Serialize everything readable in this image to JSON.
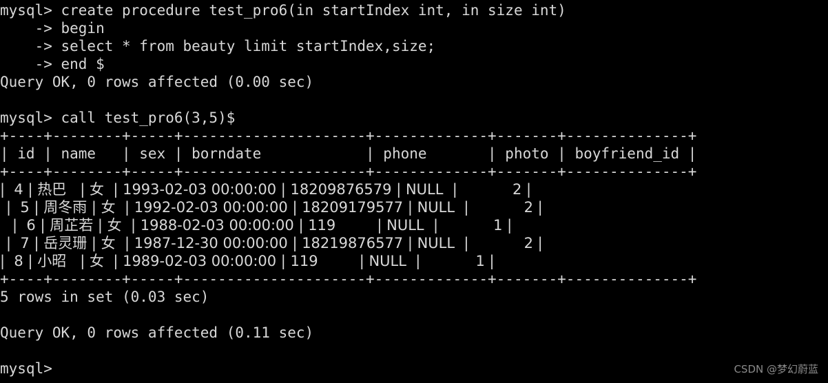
{
  "terminal": {
    "prompt": "mysql>",
    "continuation_prompt": "    ->",
    "background_color": "#000000",
    "foreground_color": "#d8d8d8",
    "cols": 92,
    "rows": 21
  },
  "session": {
    "lines": [
      {
        "id": "l01",
        "kind": "command",
        "text": "mysql> create procedure test_pro6(in startIndex int, in size int)"
      },
      {
        "id": "l02",
        "kind": "continuation",
        "text": "    -> begin"
      },
      {
        "id": "l03",
        "kind": "continuation",
        "text": "    -> select * from beauty limit startIndex,size;"
      },
      {
        "id": "l04",
        "kind": "continuation",
        "text": "    -> end $"
      },
      {
        "id": "l05",
        "kind": "status",
        "text": "Query OK, 0 rows affected (0.00 sec)"
      },
      {
        "id": "l06",
        "kind": "blank",
        "text": " "
      },
      {
        "id": "l07",
        "kind": "command",
        "text": "mysql> call test_pro6(3,5)$"
      }
    ],
    "result_footer": [
      {
        "id": "f01",
        "kind": "status",
        "text": "5 rows in set (0.03 sec)"
      },
      {
        "id": "f02",
        "kind": "blank",
        "text": " "
      },
      {
        "id": "f03",
        "kind": "status",
        "text": "Query OK, 0 rows affected (0.11 sec)"
      },
      {
        "id": "f04",
        "kind": "blank",
        "text": " "
      },
      {
        "id": "f05",
        "kind": "command",
        "text": "mysql>"
      }
    ]
  },
  "result_table": {
    "border_top": "+----+--------+-----+---------------------+-------------+-------+--------------+",
    "border_header": "+----+--------+-----+---------------------+-------------+-------+--------------+",
    "border_bottom": "+----+--------+-----+---------------------+-------------+-------+--------------+",
    "header_line": "| id | name   | sex | borndate            | phone       | photo | boyfriend_id |",
    "columns": [
      "id",
      "name",
      "sex",
      "borndate",
      "phone",
      "photo",
      "boyfriend_id"
    ],
    "rows": [
      {
        "line": "|  4 | 热巴   | 女  | 1993-02-03 00:00:00 | 18209876579 | NULL  |            2 |",
        "id": "4",
        "name": "热巴",
        "sex": "女",
        "borndate": "1993-02-03 00:00:00",
        "phone": "18209876579",
        "photo": "NULL",
        "boyfriend_id": "2"
      },
      {
        "line": "|  5 | 周冬雨 | 女  | 1992-02-03 00:00:00 | 18209179577 | NULL  |            2 |",
        "id": "5",
        "name": "周冬雨",
        "sex": "女",
        "borndate": "1992-02-03 00:00:00",
        "phone": "18209179577",
        "photo": "NULL",
        "boyfriend_id": "2"
      },
      {
        "line": "|  6 | 周芷若 | 女  | 1988-02-03 00:00:00 | 119         | NULL  |            1 |",
        "id": "6",
        "name": "周芷若",
        "sex": "女",
        "borndate": "1988-02-03 00:00:00",
        "phone": "119",
        "photo": "NULL",
        "boyfriend_id": "1"
      },
      {
        "line": "|  7 | 岳灵珊 | 女  | 1987-12-30 00:00:00 | 18219876577 | NULL  |            2 |",
        "id": "7",
        "name": "岳灵珊",
        "sex": "女",
        "borndate": "1987-12-30 00:00:00",
        "phone": "18219876577",
        "photo": "NULL",
        "boyfriend_id": "2"
      },
      {
        "line": "|  8 | 小昭   | 女  | 1989-02-03 00:00:00 | 119         | NULL  |            1 |",
        "id": "8",
        "name": "小昭",
        "sex": "女",
        "borndate": "1989-02-03 00:00:00",
        "phone": "119",
        "photo": "NULL",
        "boyfriend_id": "1"
      }
    ],
    "row_count": 5
  },
  "watermark": {
    "text": "CSDN @梦幻蔚蓝",
    "color": "#8a8a8a"
  }
}
